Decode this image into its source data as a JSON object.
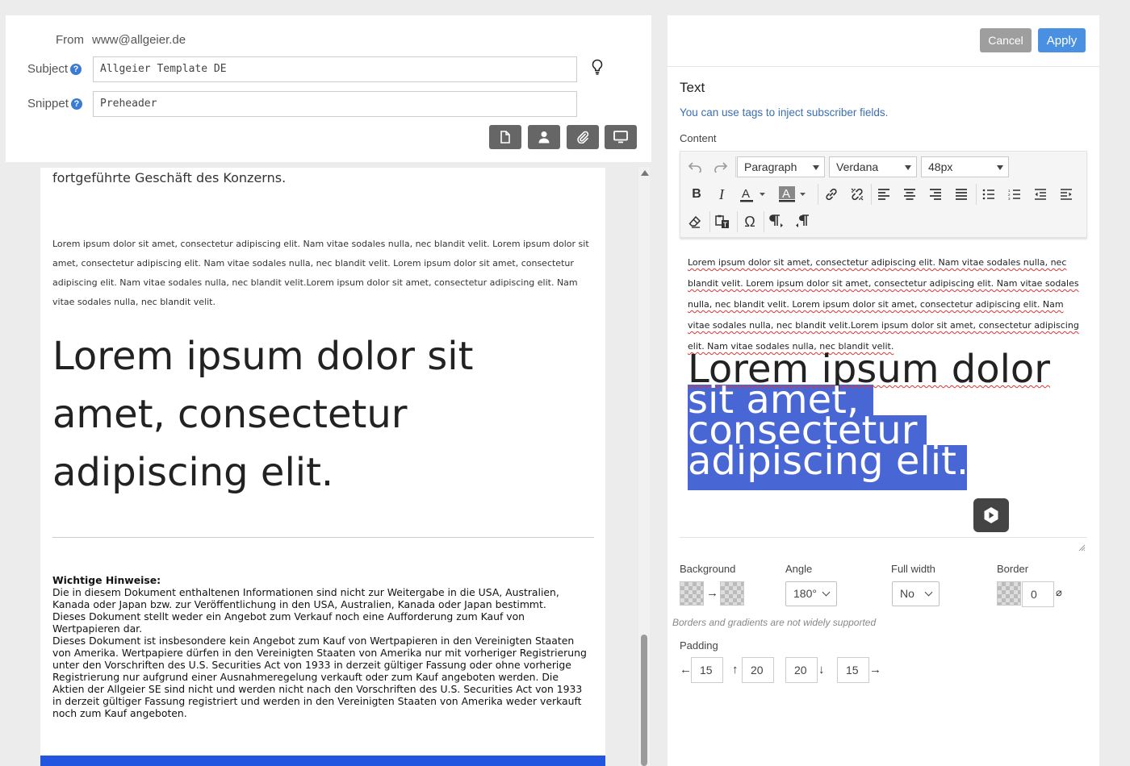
{
  "header": {
    "from_label": "From",
    "from_value": "www@allgeier.de",
    "subject_label": "Subject",
    "subject_value": "Allgeier Template DE",
    "snippet_label": "Snippet",
    "snippet_value": "Preheader",
    "help_glyph": "?"
  },
  "preview": {
    "lead_text": "fortgeführte Geschäft des Konzerns.",
    "body_text": "Lorem ipsum dolor sit amet, consectetur adipiscing elit. Nam vitae sodales nulla, nec blandit velit. Lorem ipsum dolor sit amet, consectetur adipiscing elit. Nam vitae sodales nulla, nec blandit velit. Lorem ipsum dolor sit amet, consectetur adipiscing elit. Nam vitae sodales nulla, nec blandit velit.Lorem ipsum dolor sit amet, consectetur adipiscing elit. Nam vitae sodales nulla, nec blandit velit.",
    "big_text": "Lorem ipsum dolor sit amet, consectetur adipiscing elit.",
    "notes_title": "Wichtige Hinweise:",
    "notes_lines": [
      "Die in diesem Dokument enthaltenen Informationen sind nicht zur Weitergabe in die USA, Australien, Kanada oder Japan bzw. zur Veröffentlichung in den USA, Australien, Kanada oder Japan bestimmt.",
      "Dieses Dokument stellt weder ein Angebot zum Verkauf noch eine Aufforderung zum Kauf von Wertpapieren dar.",
      "Dieses Dokument ist insbesondere kein Angebot zum Kauf von Wertpapieren in den Vereinigten Staaten von Amerika. Wertpapiere dürfen in den Vereinigten Staaten von Amerika nur mit vorheriger Registrierung unter den Vorschriften des U.S. Securities Act von 1933 in derzeit gültiger Fassung oder ohne vorherige Registrierung nur aufgrund einer Ausnahmeregelung verkauft oder zum Kauf angeboten werden. Die Aktien der Allgeier SE sind nicht und werden nicht nach den Vorschriften des U.S. Securities Act von 1933 in derzeit gültiger Fassung registriert und werden in den Vereinigten Staaten von Amerika weder verkauft noch zum Kauf angeboten."
    ],
    "banner_color": "#2356e0"
  },
  "panel": {
    "cancel_label": "Cancel",
    "apply_label": "Apply",
    "title": "Text",
    "hint": "You can use tags to inject subscriber fields.",
    "content_label": "Content",
    "block_format": "Paragraph",
    "font_family": "Verdana",
    "font_size": "48px",
    "editor_small_text": "Lorem ipsum dolor sit amet, consectetur adipiscing elit. Nam vitae sodales nulla, nec blandit velit. Lorem ipsum dolor sit amet, consectetur adipiscing elit. Nam vitae sodales nulla, nec blandit velit. Lorem ipsum dolor sit amet, consectetur adipiscing elit. Nam vitae sodales nulla, nec blandit velit.Lorem ipsum dolor sit amet, consectetur adipiscing elit. Nam vitae sodales nulla, nec blandit velit.",
    "editor_big_lines": [
      "Lorem ipsum dolor",
      "sit amet,",
      "consectetur",
      "adipiscing elit."
    ],
    "toolbar_icons": [
      "undo-icon",
      "redo-icon",
      "bold-icon",
      "italic-icon",
      "text-color-icon",
      "background-color-icon",
      "link-icon",
      "unlink-icon",
      "align-left-icon",
      "align-center-icon",
      "align-right-icon",
      "align-justify-icon",
      "bullet-list-icon",
      "numbered-list-icon",
      "outdent-icon",
      "indent-icon",
      "remove-format-icon",
      "paste-text-icon",
      "special-character-icon",
      "ltr-icon",
      "rtl-icon"
    ]
  },
  "settings": {
    "background_label": "Background",
    "angle_label": "Angle",
    "angle_value": "180°",
    "fullwidth_label": "Full width",
    "fullwidth_value": "No",
    "border_label": "Border",
    "border_value": "0",
    "no_border_glyph": "⌀",
    "gradient_arrow": "→",
    "warning": "Borders and gradients are not widely supported",
    "padding_label": "Padding",
    "padding_left": "15",
    "padding_top": "20",
    "padding_bottom": "20",
    "padding_right": "15",
    "arrow_left": "←",
    "arrow_up": "↑",
    "arrow_down": "↓",
    "arrow_right": "→"
  }
}
